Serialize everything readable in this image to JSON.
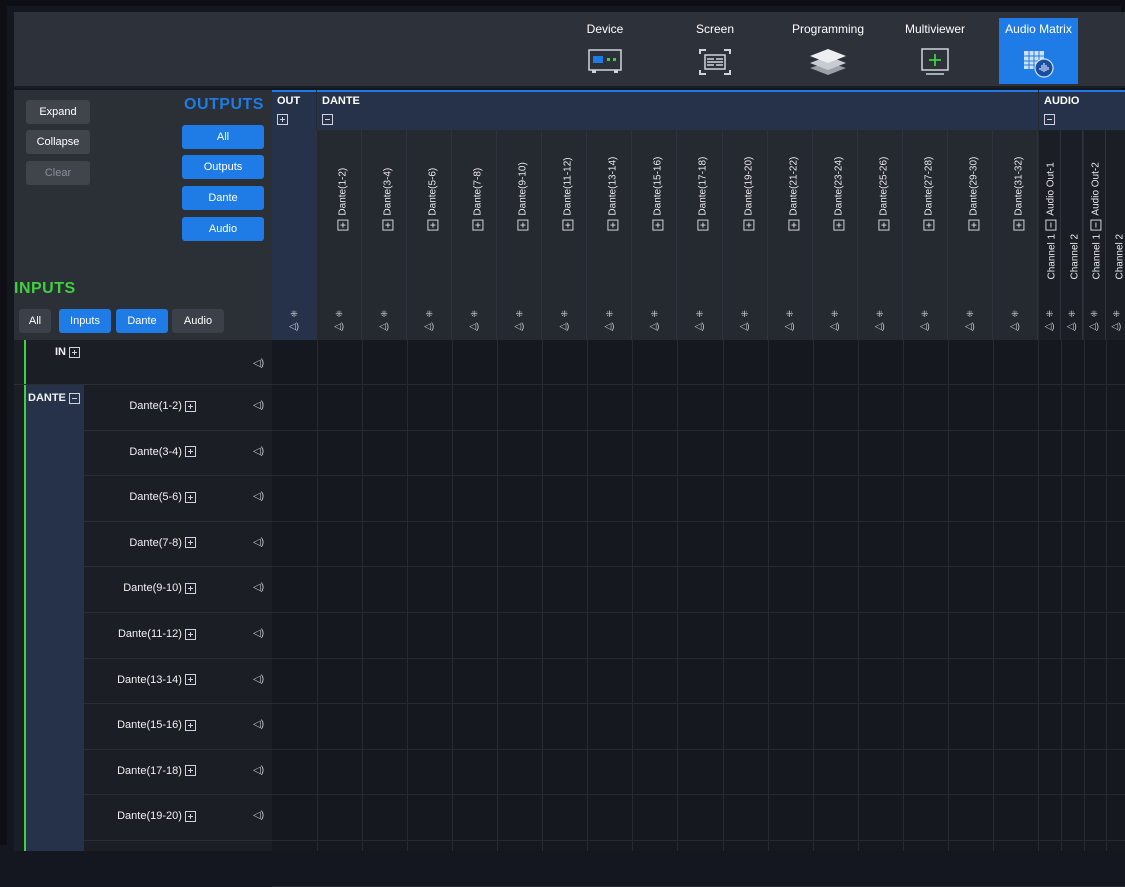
{
  "nav": {
    "items": [
      {
        "label": "Device",
        "icon": "device-icon"
      },
      {
        "label": "Screen",
        "icon": "screen-icon"
      },
      {
        "label": "Programming",
        "icon": "layers-icon"
      },
      {
        "label": "Multiviewer",
        "icon": "multiviewer-icon"
      },
      {
        "label": "Audio Matrix",
        "icon": "audio-matrix-icon",
        "active": true
      }
    ]
  },
  "controls": {
    "expand": "Expand",
    "collapse": "Collapse",
    "clear": "Clear",
    "outputs_title": "OUTPUTS",
    "outputs_filters": [
      "All",
      "Outputs",
      "Dante",
      "Audio"
    ],
    "inputs_title": "INPUTS",
    "inputs_filters": [
      "All",
      "Inputs",
      "Dante",
      "Audio"
    ]
  },
  "output_groups": {
    "out": "OUT",
    "dante": "DANTE",
    "audio": "AUDIO"
  },
  "dante_outputs": [
    "Dante(1-2)",
    "Dante(3-4)",
    "Dante(5-6)",
    "Dante(7-8)",
    "Dante(9-10)",
    "Dante(11-12)",
    "Dante(13-14)",
    "Dante(15-16)",
    "Dante(17-18)",
    "Dante(19-20)",
    "Dante(21-22)",
    "Dante(23-24)",
    "Dante(25-26)",
    "Dante(27-28)",
    "Dante(29-30)",
    "Dante(31-32)"
  ],
  "audio_outputs": [
    {
      "name": "Audio Out-1",
      "channels": [
        "Channel 1",
        "Channel 2"
      ]
    },
    {
      "name": "Audio Out-2",
      "channels": [
        "Channel 1",
        "Channel 2"
      ]
    }
  ],
  "input_groups": {
    "in": "IN",
    "dante": "DANTE"
  },
  "dante_inputs": [
    "Dante(1-2)",
    "Dante(3-4)",
    "Dante(5-6)",
    "Dante(7-8)",
    "Dante(9-10)",
    "Dante(11-12)",
    "Dante(13-14)",
    "Dante(15-16)",
    "Dante(17-18)",
    "Dante(19-20)"
  ],
  "colors": {
    "accent": "#1f7ce6",
    "inputs_title": "#3fd13f",
    "outputs_title": "#1f7ce6"
  }
}
